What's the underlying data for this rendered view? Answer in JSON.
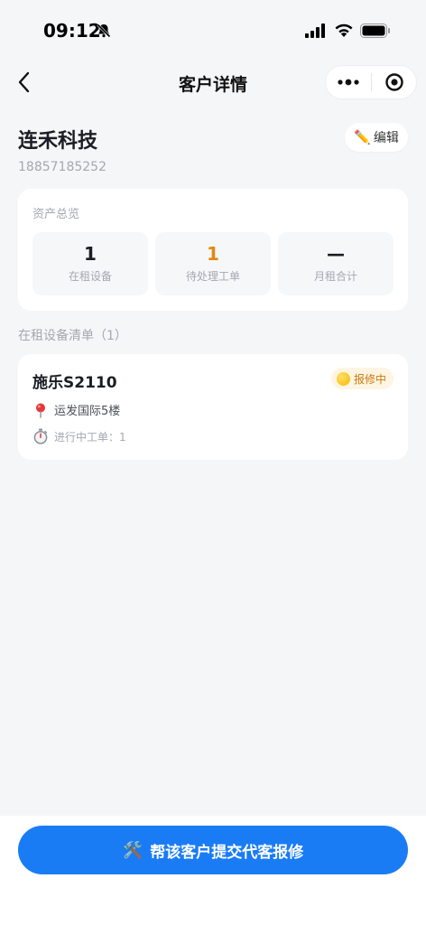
{
  "status_bar": {
    "time": "09:12"
  },
  "nav": {
    "title": "客户详情"
  },
  "customer": {
    "name": "连禾科技",
    "phone": "18857185252",
    "edit_label": "编辑"
  },
  "assets": {
    "title": "资产总览",
    "stats": [
      {
        "value": "1",
        "label": "在租设备"
      },
      {
        "value": "1",
        "label": "待处理工单"
      },
      {
        "value": "—",
        "label": "月租合计"
      }
    ]
  },
  "device_list": {
    "title": "在租设备清单（1）",
    "devices": [
      {
        "name": "施乐S2110",
        "status": "报修中",
        "location": "运发国际5楼",
        "orders": "进行中工单：1"
      }
    ]
  },
  "action": {
    "submit_label": "帮该客户提交代客报修"
  },
  "colors": {
    "primary": "#1a7cf5",
    "warning": "#e08a0b",
    "background": "#f5f6f8"
  }
}
